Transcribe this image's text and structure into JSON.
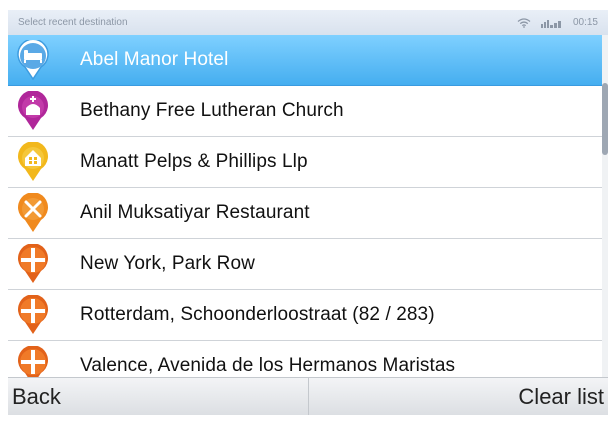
{
  "header": {
    "title": "Select recent destination",
    "signal_text": "³ᴳˢᵈ",
    "time": "00:15",
    "wifi_icon": "wifi-icon",
    "signal_icon": "signal-icon"
  },
  "list": {
    "items": [
      {
        "label": "Abel Manor Hotel",
        "icon": "hotel-icon",
        "color": "#5aa9e6",
        "selected": true
      },
      {
        "label": "Bethany Free Lutheran Church",
        "icon": "church-icon",
        "color": "#b0279a",
        "selected": false
      },
      {
        "label": "Manatt Pelps & Phillips Llp",
        "icon": "office-icon",
        "color": "#f2b81c",
        "selected": false
      },
      {
        "label": "Anil Muksatiyar Restaurant",
        "icon": "restaurant-icon",
        "color": "#f08a1e",
        "selected": false
      },
      {
        "label": "New York, Park Row",
        "icon": "address-icon",
        "color": "#f07a28",
        "selected": false
      },
      {
        "label": "Rotterdam, Schoonderloostraat (82 / 283)",
        "icon": "address-icon",
        "color": "#f07a28",
        "selected": false
      },
      {
        "label": "Valence, Avenida de los Hermanos Maristas",
        "icon": "address-icon",
        "color": "#f07a28",
        "selected": false
      }
    ]
  },
  "softkeys": {
    "left_label": "Back",
    "right_label": "Clear list"
  }
}
